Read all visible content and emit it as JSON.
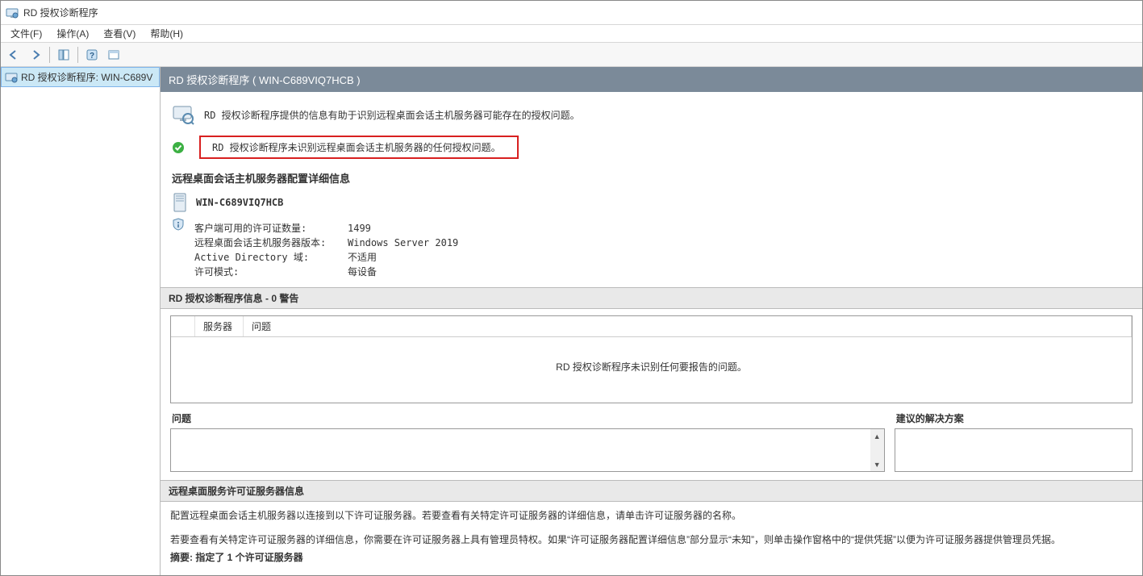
{
  "window": {
    "title": "RD 授权诊断程序"
  },
  "menu": {
    "file": "文件(F)",
    "action": "操作(A)",
    "view": "查看(V)",
    "help": "帮助(H)"
  },
  "sidebar": {
    "node": "RD 授权诊断程序: WIN-C689V"
  },
  "header": {
    "title": "RD 授权诊断程序 ( WIN-C689VIQ7HCB )"
  },
  "intro": "RD 授权诊断程序提供的信息有助于识别远程桌面会话主机服务器可能存在的授权问题。",
  "status_ok": "RD 授权诊断程序未识别远程桌面会话主机服务器的任何授权问题。",
  "config_section": "远程桌面会话主机服务器配置详细信息",
  "server_name": "WIN-C689VIQ7HCB",
  "details": {
    "row1": {
      "label": "客户端可用的许可证数量:",
      "value": "1499"
    },
    "row2": {
      "label": "远程桌面会话主机服务器版本:",
      "value": "Windows Server 2019"
    },
    "row3": {
      "label": "Active Directory 域:",
      "value": "不适用"
    },
    "row4": {
      "label": "许可模式:",
      "value": "每设备"
    }
  },
  "warn_panel": {
    "title": "RD 授权诊断程序信息 - 0 警告",
    "col_server": "服务器",
    "col_issue": "问题",
    "empty": "RD 授权诊断程序未识别任何要报告的问题。"
  },
  "split": {
    "issue": "问题",
    "solution": "建议的解决方案"
  },
  "lic_server": {
    "title": "远程桌面服务许可证服务器信息",
    "line1": "配置远程桌面会话主机服务器以连接到以下许可证服务器。若要查看有关特定许可证服务器的详细信息，请单击许可证服务器的名称。",
    "line2": "若要查看有关特定许可证服务器的详细信息，你需要在许可证服务器上具有管理员特权。如果“许可证服务器配置详细信息”部分显示“未知”，则单击操作窗格中的“提供凭据”以便为许可证服务器提供管理员凭据。",
    "summary": "摘要: 指定了 1 个许可证服务器"
  }
}
